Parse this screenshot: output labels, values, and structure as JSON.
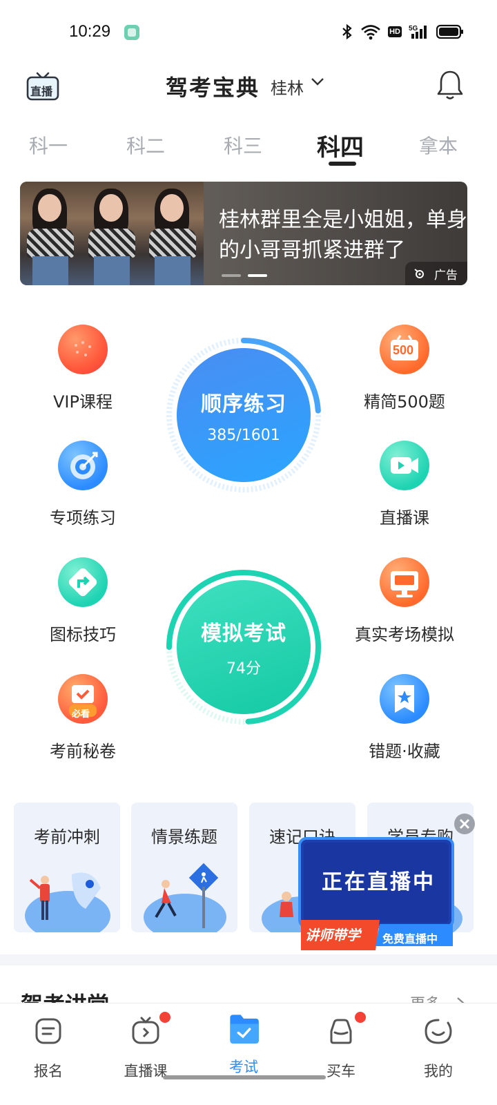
{
  "status_bar": {
    "time": "10:29",
    "icons": [
      "app-notification-icon",
      "bluetooth-icon",
      "wifi-icon",
      "hd-icon",
      "5g-signal-icon",
      "battery-icon"
    ],
    "hd_label": "HD",
    "network_label": "5G"
  },
  "header": {
    "live_icon_label": "直播",
    "title": "驾考宝典",
    "city": "桂林",
    "icons": [
      "live-tv-icon",
      "chevron-down-icon",
      "bell-icon"
    ]
  },
  "tabs": [
    {
      "label": "科一",
      "active": false
    },
    {
      "label": "科二",
      "active": false
    },
    {
      "label": "科三",
      "active": false
    },
    {
      "label": "科四",
      "active": true
    },
    {
      "label": "拿本",
      "active": false
    }
  ],
  "banner": {
    "text": "桂林群里全是小姐姐，单身的小哥哥抓紧进群了",
    "ad_label": "广告",
    "slide_count": 2,
    "active_slide": 2
  },
  "practice": {
    "sequential": {
      "title": "顺序练习",
      "progress": "385/1601",
      "done": 385,
      "total": 1601
    },
    "mock_exam": {
      "title": "模拟考试",
      "score": "74分",
      "score_value": 74
    }
  },
  "features_left": [
    {
      "label": "VIP课程",
      "icon": "vip-course-icon"
    },
    {
      "label": "专项练习",
      "icon": "target-icon"
    },
    {
      "label": "图标技巧",
      "icon": "road-sign-icon"
    },
    {
      "label": "考前秘卷",
      "icon": "must-read-icon",
      "badge": "必看"
    }
  ],
  "features_right": [
    {
      "label": "精简500题",
      "icon": "500-questions-icon",
      "badge": "500"
    },
    {
      "label": "直播课",
      "icon": "video-camera-icon"
    },
    {
      "label": "真实考场模拟",
      "icon": "monitor-icon"
    },
    {
      "label": "错题·收藏",
      "icon": "bookmark-star-icon"
    }
  ],
  "cards": [
    {
      "title": "考前冲刺"
    },
    {
      "title": "情景练题"
    },
    {
      "title": "速记口诀"
    },
    {
      "title": "学员专购"
    }
  ],
  "live_popup": {
    "line1": "正在直播中",
    "line2": "讲师带学",
    "line3": "免费直播中"
  },
  "section": {
    "title": "驾考讲堂",
    "more": "更多"
  },
  "bottom_nav": [
    {
      "label": "报名",
      "icon": "signup-icon",
      "dot": false,
      "active": false
    },
    {
      "label": "直播课",
      "icon": "tv-icon",
      "dot": true,
      "active": false
    },
    {
      "label": "考试",
      "icon": "exam-folder-icon",
      "dot": false,
      "active": true
    },
    {
      "label": "买车",
      "icon": "car-icon",
      "dot": true,
      "active": false
    },
    {
      "label": "我的",
      "icon": "smile-icon",
      "dot": false,
      "active": false
    }
  ],
  "colors": {
    "accent_blue": "#2b8bff",
    "mock_green": "#1ed3b2",
    "notification_red": "#f44336"
  }
}
